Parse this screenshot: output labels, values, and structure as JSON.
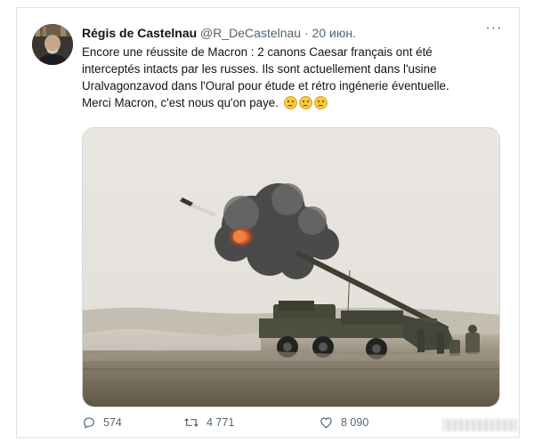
{
  "tweet": {
    "author_name": "Régis de Castelnau",
    "author_handle": "@R_DeCastelnau",
    "separator": "·",
    "date": "20 июн.",
    "more_label": "···",
    "lines": [
      "Encore une réussite de Macron : 2 canons Caesar français ont été",
      "interceptés intacts par les russes. Ils sont actuellement dans l'usine",
      "Uralvagonzavod dans l'Oural pour étude et rétro ingénerie éventuelle.",
      "Merci Macron, c'est nous qu'on paye."
    ],
    "emoji_count": 3
  },
  "actions": {
    "replies": "574",
    "retweets": "4 771",
    "likes": "8 090"
  },
  "colors": {
    "text": "#0f1419",
    "secondary": "#536471",
    "border": "#dfe3e6"
  },
  "icons": [
    "reply-icon",
    "retweet-icon",
    "like-icon",
    "more-icon"
  ]
}
